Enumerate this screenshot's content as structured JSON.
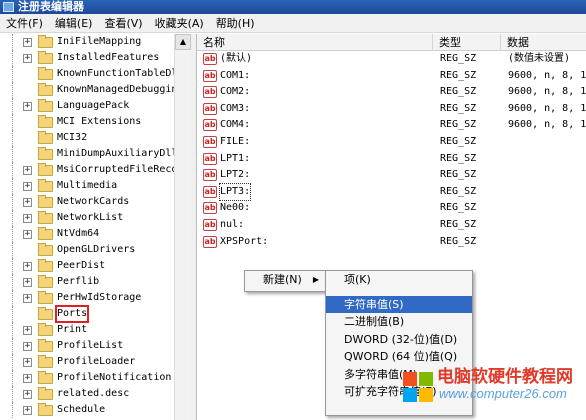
{
  "window": {
    "title": "注册表编辑器"
  },
  "menubar": [
    "文件(F)",
    "编辑(E)",
    "查看(V)",
    "收藏夹(A)",
    "帮助(H)"
  ],
  "tree": {
    "items": [
      {
        "label": "IniFileMapping",
        "expander": "+"
      },
      {
        "label": "InstalledFeatures",
        "expander": "+"
      },
      {
        "label": "KnownFunctionTableDl",
        "expander": ""
      },
      {
        "label": "KnownManagedDebuggin",
        "expander": ""
      },
      {
        "label": "LanguagePack",
        "expander": "+"
      },
      {
        "label": "MCI Extensions",
        "expander": ""
      },
      {
        "label": "MCI32",
        "expander": ""
      },
      {
        "label": "MiniDumpAuxiliaryDll",
        "expander": ""
      },
      {
        "label": "MsiCorruptedFileReco",
        "expander": "+"
      },
      {
        "label": "Multimedia",
        "expander": "+"
      },
      {
        "label": "NetworkCards",
        "expander": "+"
      },
      {
        "label": "NetworkList",
        "expander": "+"
      },
      {
        "label": "NtVdm64",
        "expander": "+"
      },
      {
        "label": "OpenGLDrivers",
        "expander": ""
      },
      {
        "label": "PeerDist",
        "expander": "+"
      },
      {
        "label": "Perflib",
        "expander": "+"
      },
      {
        "label": "PerHwIdStorage",
        "expander": "+"
      },
      {
        "label": "Ports",
        "expander": ""
      },
      {
        "label": "Print",
        "expander": "+"
      },
      {
        "label": "ProfileList",
        "expander": "+"
      },
      {
        "label": "ProfileLoader",
        "expander": "+"
      },
      {
        "label": "ProfileNotification",
        "expander": "+"
      },
      {
        "label": "related.desc",
        "expander": "+"
      },
      {
        "label": "Schedule",
        "expander": "+"
      }
    ]
  },
  "list": {
    "columns": {
      "name": "名称",
      "type": "类型",
      "data": "数据"
    },
    "rows": [
      {
        "name": "(默认)",
        "type": "REG_SZ",
        "data": "(数值未设置)"
      },
      {
        "name": "COM1:",
        "type": "REG_SZ",
        "data": "9600, n, 8, 1"
      },
      {
        "name": "COM2:",
        "type": "REG_SZ",
        "data": "9600, n, 8, 1"
      },
      {
        "name": "COM3:",
        "type": "REG_SZ",
        "data": "9600, n, 8, 1"
      },
      {
        "name": "COM4:",
        "type": "REG_SZ",
        "data": "9600, n, 8, 1"
      },
      {
        "name": "FILE:",
        "type": "REG_SZ",
        "data": ""
      },
      {
        "name": "LPT1:",
        "type": "REG_SZ",
        "data": ""
      },
      {
        "name": "LPT2:",
        "type": "REG_SZ",
        "data": ""
      },
      {
        "name": "LPT3:",
        "type": "REG_SZ",
        "data": ""
      },
      {
        "name": "Ne00:",
        "type": "REG_SZ",
        "data": ""
      },
      {
        "name": "nul:",
        "type": "REG_SZ",
        "data": ""
      },
      {
        "name": "XPSPort:",
        "type": "REG_SZ",
        "data": ""
      }
    ],
    "value_icon_text": "ab"
  },
  "context_menu": {
    "new_label": "新建(N)"
  },
  "submenu": {
    "items": [
      {
        "label": "项(K)"
      },
      {
        "label": "字符串值(S)"
      },
      {
        "label": "二进制值(B)"
      },
      {
        "label": "DWORD (32-位)值(D)"
      },
      {
        "label": "QWORD (64 位)值(Q)"
      },
      {
        "label": "多字符串值(M)"
      },
      {
        "label": "可扩充字符串值(E)"
      }
    ]
  },
  "watermark": {
    "title": "电脑软硬件教程网",
    "url": "www.computer26.com"
  },
  "colors": {
    "selection": "#316ac5",
    "highlight_box": "#dd2222",
    "watermark_title": "#e23a2a",
    "watermark_url": "#5aa0e0"
  }
}
